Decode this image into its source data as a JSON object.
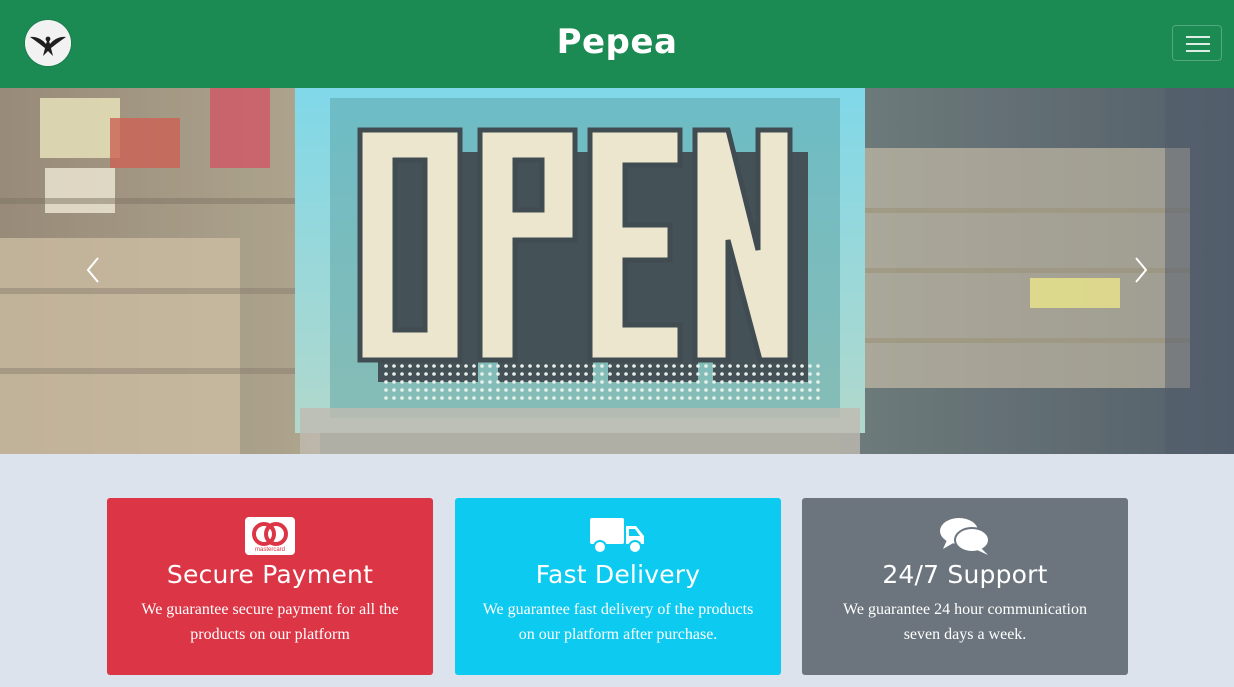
{
  "navbar": {
    "brand": "Pepea",
    "logo_icon": "bird-logo-icon",
    "menu_icon": "hamburger-menu-icon",
    "background": "#1b8a53"
  },
  "carousel": {
    "image_sign_text": "OPEN",
    "prev_icon": "chevron-left-icon",
    "next_icon": "chevron-right-icon"
  },
  "features": [
    {
      "icon": "mastercard-icon",
      "icon_label": "mastercard",
      "title": "Secure Payment",
      "text": "We guarantee secure payment for all the products on our platform",
      "color": "#dc3545"
    },
    {
      "icon": "delivery-truck-icon",
      "title": "Fast Delivery",
      "text": "We guarantee fast delivery of the products on our platform after purchase.",
      "color": "#0dcaf0"
    },
    {
      "icon": "chat-bubbles-icon",
      "title": "24/7 Support",
      "text": "We guarantee 24 hour communication seven days a week.",
      "color": "#6c757d"
    }
  ]
}
